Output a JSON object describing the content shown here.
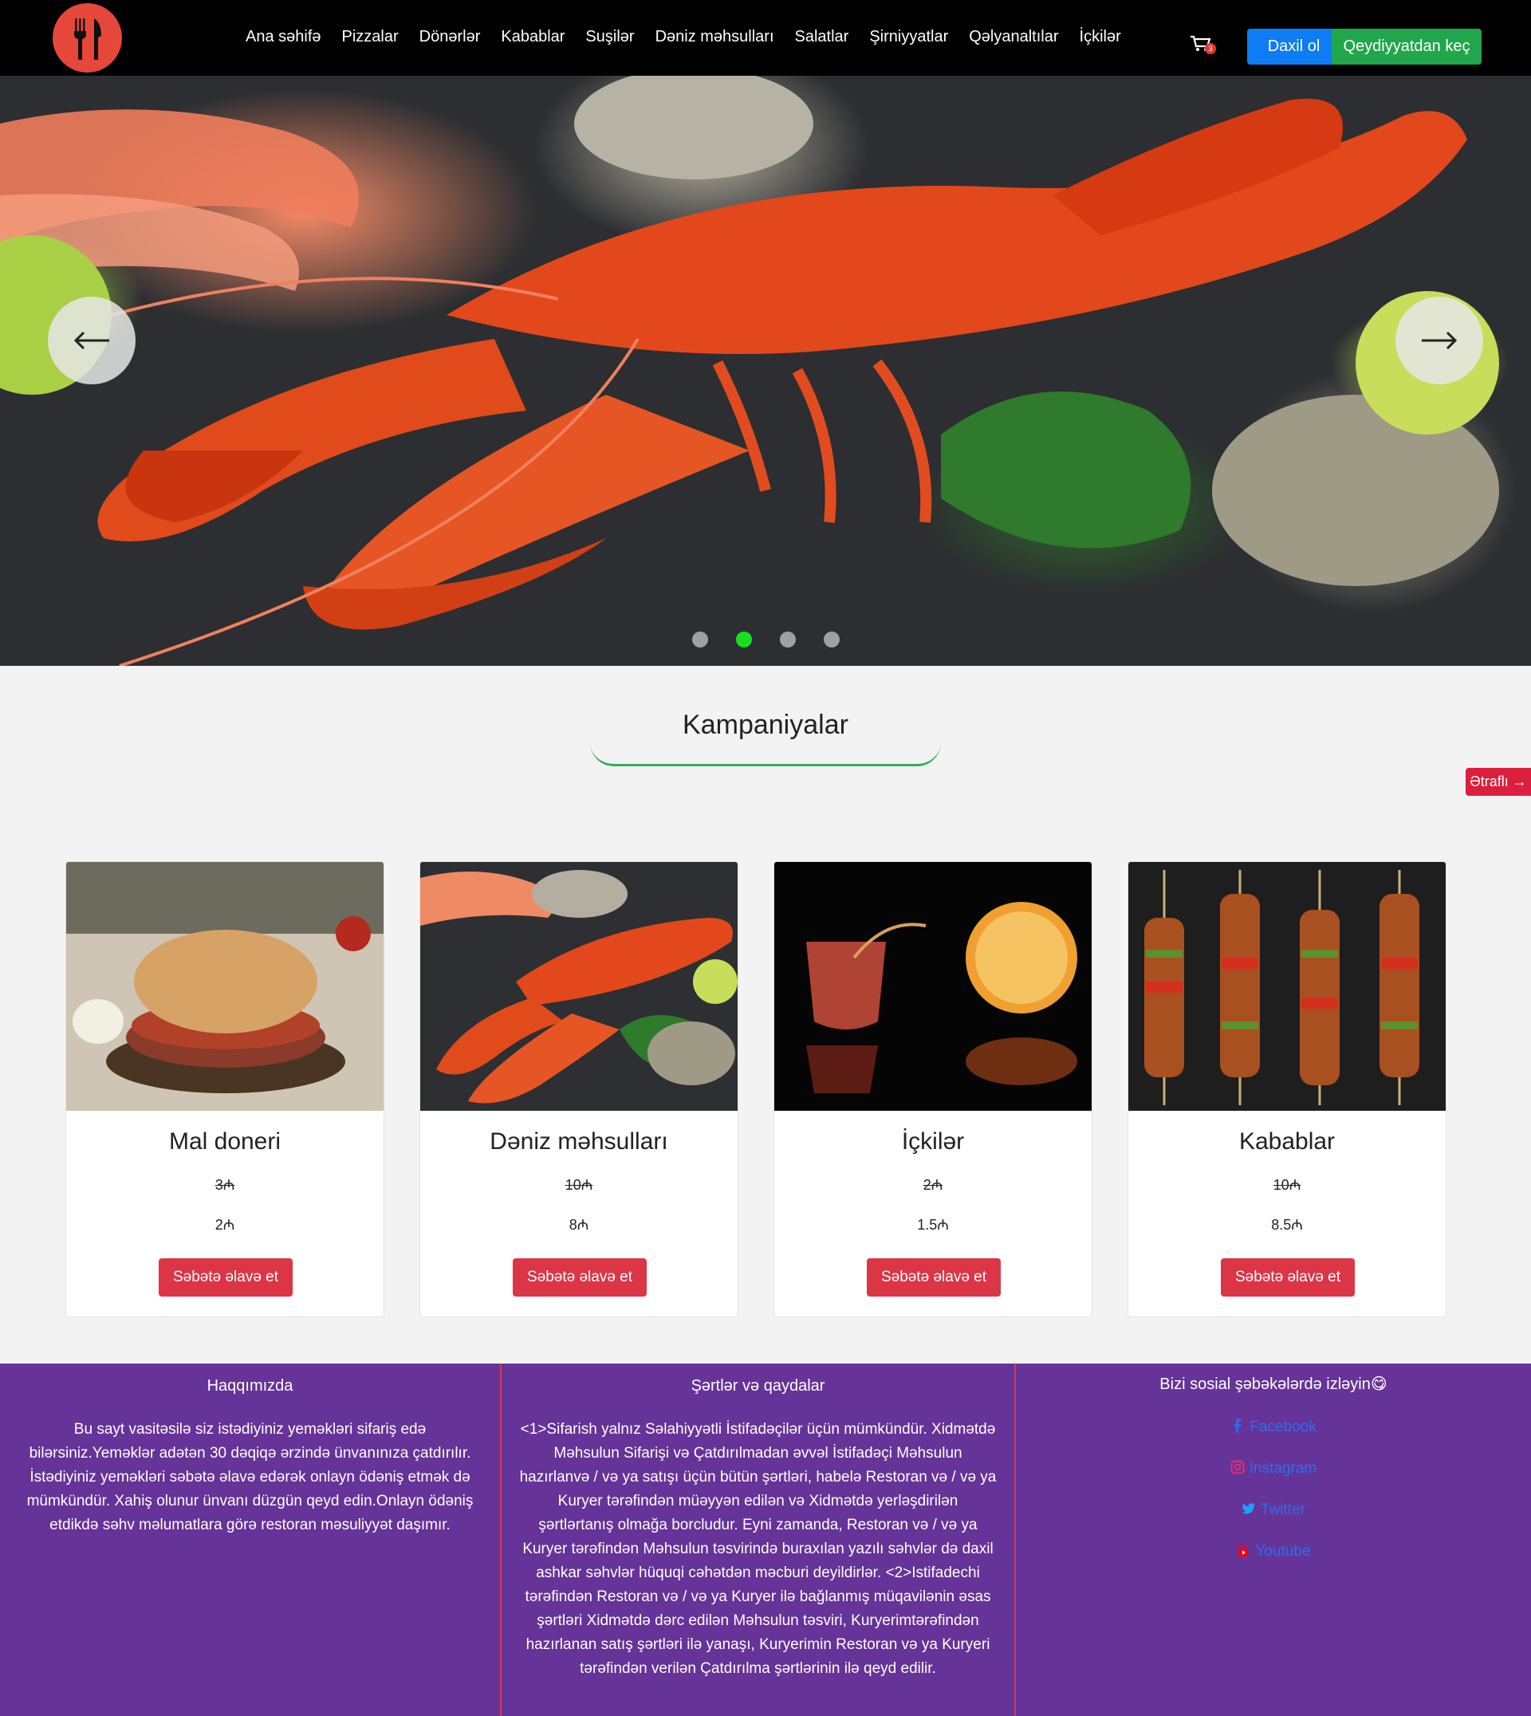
{
  "nav": {
    "items": [
      "Ana səhifə",
      "Pizzalar",
      "Dönərlər",
      "Kabablar",
      "Suşilər",
      "Dəniz məhsulları",
      "Salatlar",
      "Şirniyyatlar",
      "Qəlyanaltılar",
      "İçkilər"
    ],
    "cart_count": "3",
    "login_label": "Daxil ol",
    "register_label": "Qeydiyyatdan keç"
  },
  "carousel": {
    "active_index": 1,
    "dot_count": 4
  },
  "campaigns": {
    "title": "Kampaniyalar",
    "more_label": "Ətraflı →",
    "cards": [
      {
        "title": "Mal doneri",
        "old_price": "3₼",
        "new_price": "2₼",
        "button": "Səbətə əlavə et"
      },
      {
        "title": "Dəniz məhsulları",
        "old_price": "10₼",
        "new_price": "8₼",
        "button": "Səbətə əlavə et"
      },
      {
        "title": "İçkilər",
        "old_price": "2₼",
        "new_price": "1.5₼",
        "button": "Səbətə əlavə et"
      },
      {
        "title": "Kabablar",
        "old_price": "10₼",
        "new_price": "8.5₼",
        "button": "Səbətə əlavə et"
      }
    ]
  },
  "footer": {
    "about_title": "Haqqımızda",
    "about_text": "Bu sayt vasitəsilə siz istədiyiniz yeməkləri sifariş edə bilərsiniz.Yeməklər adətən 30 dəqiqə ərzində ünvanınıza çatdırılır. İstədiyiniz yeməkləri səbətə əlavə edərək onlayn ödəniş etmək də mümkündür. Xahiş olunur ünvanı düzgün qeyd edin.Onlayn ödəniş etdikdə səhv məlumatlara görə restoran məsuliyyət daşımır.",
    "terms_title": "Şərtlər və qaydalar",
    "terms_text": "<1>Sifarish yalnız Səlahiyyətli İstifadəçilər üçün mümkündür. Xidmətdə Məhsulun Sifarişi və Çatdırılmadan əvvəl İstifadəçi Məhsulun hazırlanvə / və ya satışı üçün bütün şərtləri, habelə Restoran və / və ya Kuryer tərəfindən müəyyən edilən və Xidmətdə yerləşdirilən şərtlərtanış olmağa borcludur. Eyni zamanda, Restoran və / və ya Kuryer tərəfindən Məhsulun təsvirində buraxılan yazılı səhvlər də daxil ashkar səhvlər hüquqi cəhətdən məcburi deyildirlər. <2>Istifadechi tərəfindən Restoran və / və ya Kuryer ilə bağlanmış müqavilənin əsas şərtləri Xidmətdə dərc edilən Məhsulun təsviri, Kuryerimtərəfindən hazırlanan satış şərtləri ilə yanaşı, Kuryerimin Restoran və ya Kuryeri tərəfindən verilən Çatdırılma şərtlərinin ilə qeyd edilir.",
    "social_title": "Bizi sosial şəbəkələrdə izləyin😋",
    "social": [
      {
        "label": "Facebook",
        "icon": "facebook-icon",
        "color": "#2b6ee8"
      },
      {
        "label": "Instagram",
        "icon": "instagram-icon",
        "color": "#e1306c"
      },
      {
        "label": "Twitter",
        "icon": "twitter-icon",
        "color": "#1da1f2"
      },
      {
        "label": "Youtube",
        "icon": "youtube-icon",
        "color": "#ff0000"
      }
    ]
  },
  "colors": {
    "nav_bg": "#000000",
    "login_btn": "#0d7cf5",
    "register_btn": "#22a64c",
    "add_btn": "#dc3545",
    "footer_bg": "#663399",
    "dot_active": "#17e11d"
  }
}
